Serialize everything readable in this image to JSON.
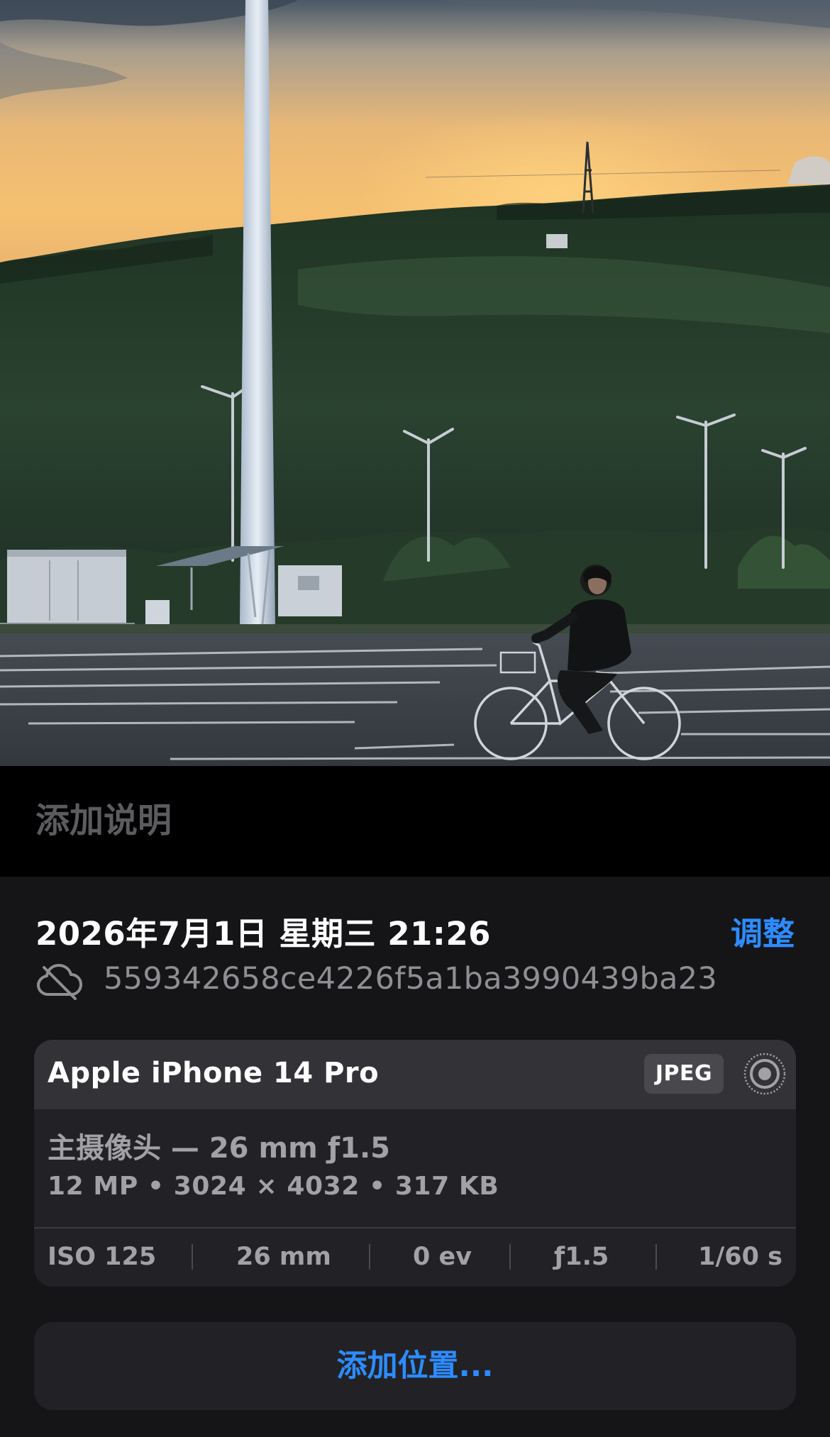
{
  "photo": {
    "icon": "photo-sunset-cyclist"
  },
  "caption": {
    "placeholder": "添加说明"
  },
  "info": {
    "date_time": "2026年7月1日 星期三 21:26",
    "adjust_label": "调整",
    "file_id": "559342658ce4226f5a1ba3990439ba23",
    "cloud_status_icon": "cloud-slash-icon"
  },
  "device": {
    "name": "Apple iPhone 14 Pro",
    "format": "JPEG",
    "live_icon": "live-photo-icon",
    "lens": "主摄像头 — 26 mm ƒ1.5",
    "specs": "12 MP • 3024 × 4032 • 317 KB",
    "exif": {
      "iso": "ISO 125",
      "focal": "26 mm",
      "ev": "0 ev",
      "aperture": "ƒ1.5",
      "shutter": "1/60 s"
    }
  },
  "location": {
    "add_label": "添加位置..."
  },
  "colors": {
    "accent": "#2d8cff",
    "background": "#151517",
    "card": "#222226",
    "card_header": "#333337"
  }
}
